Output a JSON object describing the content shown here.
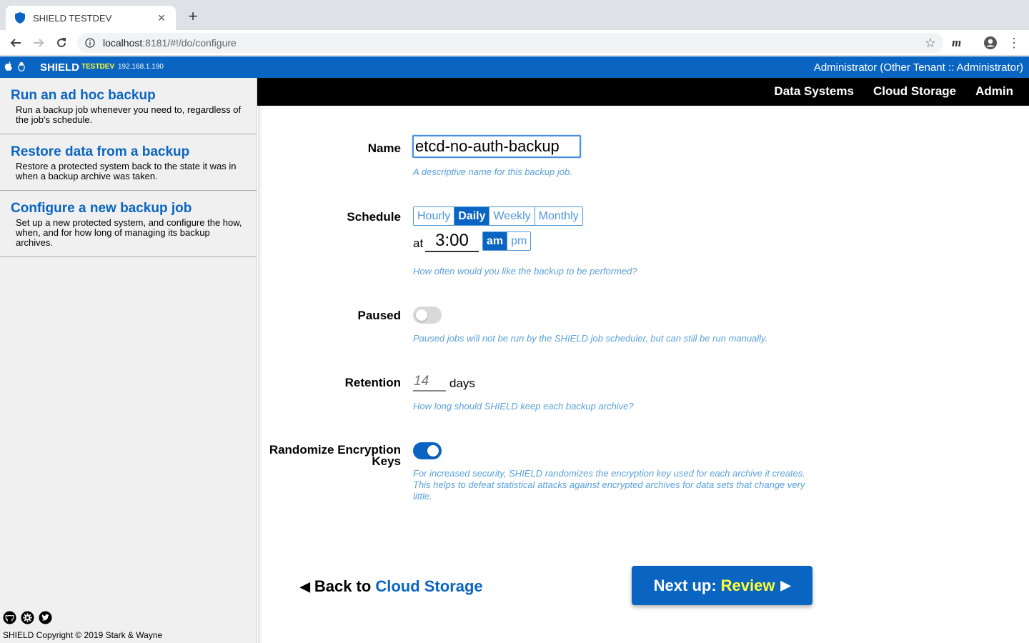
{
  "browser": {
    "tab_title": "SHIELD TESTDEV",
    "tab_close": "×",
    "new_tab": "+",
    "url_host": "localhost",
    "url_rest": ":8181/#!/do/configure",
    "ext_label": "m",
    "menu_dots": "⋮",
    "star": "☆"
  },
  "app": {
    "brand": "SHIELD",
    "env": "TESTDEV",
    "ip": "192.168.1.190",
    "user": "Administrator (Other Tenant :: Administrator)",
    "accent": "#0a65c2",
    "highlight": "#ffff33"
  },
  "nav": {
    "items": [
      "Data Systems",
      "Cloud Storage",
      "Admin"
    ]
  },
  "sidebar": {
    "items": [
      {
        "title": "Run an ad hoc backup",
        "desc": "Run a backup job whenever you need to, regardless of the job's schedule."
      },
      {
        "title": "Restore data from a backup",
        "desc": "Restore a protected system back to the state it was in when a backup archive was taken."
      },
      {
        "title": "Configure a new backup job",
        "desc": "Set up a new protected system, and configure the how, when, and for how long of managing its backup archives."
      }
    ],
    "social_icons": [
      "github-icon",
      "gear-icon",
      "twitter-icon"
    ],
    "copyright": "SHIELD Copyright © 2019 Stark & Wayne"
  },
  "form": {
    "name": {
      "label": "Name",
      "value": "etcd-no-auth-backup",
      "help": "A descriptive name for this backup job."
    },
    "schedule": {
      "label": "Schedule",
      "options": [
        "Hourly",
        "Daily",
        "Weekly",
        "Monthly"
      ],
      "selected": "Daily",
      "at_label": "at",
      "time": "3:00",
      "ampm": [
        "am",
        "pm"
      ],
      "ampm_selected": "am",
      "help": "How often would you like the backup to be performed?"
    },
    "paused": {
      "label": "Paused",
      "on": false,
      "help": "Paused jobs will not be run by the SHIELD job scheduler, but can still be run manually."
    },
    "retention": {
      "label": "Retention",
      "placeholder": "14",
      "unit": "days",
      "help": "How long should SHIELD keep each backup archive?"
    },
    "randomize": {
      "label_line1": "Randomize Encryption",
      "label_line2": "Keys",
      "on": true,
      "help_line1": "For increased security, SHIELD randomizes the encryption key used for each archive it creates.",
      "help_line2": "This helps to defeat statistical attacks against encrypted archives for data sets that change very",
      "help_line3": "little."
    }
  },
  "footer_nav": {
    "back_prefix": "Back to",
    "back_target": "Cloud Storage",
    "next_prefix": "Next up:",
    "next_target": "Review"
  }
}
